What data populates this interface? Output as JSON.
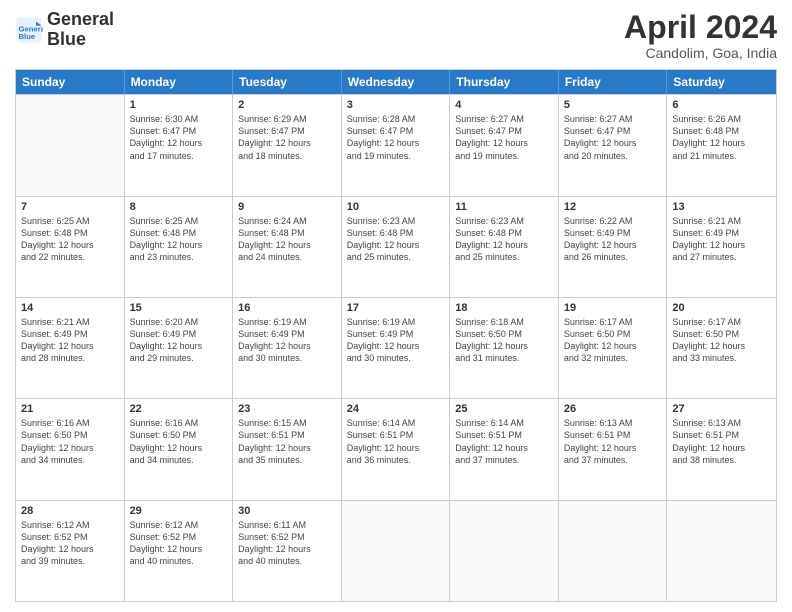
{
  "header": {
    "logo_line1": "General",
    "logo_line2": "Blue",
    "title": "April 2024",
    "subtitle": "Candolim, Goa, India"
  },
  "calendar": {
    "weekdays": [
      "Sunday",
      "Monday",
      "Tuesday",
      "Wednesday",
      "Thursday",
      "Friday",
      "Saturday"
    ],
    "weeks": [
      [
        {
          "day": "",
          "empty": true
        },
        {
          "day": "1",
          "sunrise": "6:30 AM",
          "sunset": "6:47 PM",
          "daylight": "12 hours and 17 minutes."
        },
        {
          "day": "2",
          "sunrise": "6:29 AM",
          "sunset": "6:47 PM",
          "daylight": "12 hours and 18 minutes."
        },
        {
          "day": "3",
          "sunrise": "6:28 AM",
          "sunset": "6:47 PM",
          "daylight": "12 hours and 19 minutes."
        },
        {
          "day": "4",
          "sunrise": "6:27 AM",
          "sunset": "6:47 PM",
          "daylight": "12 hours and 19 minutes."
        },
        {
          "day": "5",
          "sunrise": "6:27 AM",
          "sunset": "6:47 PM",
          "daylight": "12 hours and 20 minutes."
        },
        {
          "day": "6",
          "sunrise": "6:26 AM",
          "sunset": "6:48 PM",
          "daylight": "12 hours and 21 minutes."
        }
      ],
      [
        {
          "day": "7",
          "sunrise": "6:25 AM",
          "sunset": "6:48 PM",
          "daylight": "12 hours and 22 minutes."
        },
        {
          "day": "8",
          "sunrise": "6:25 AM",
          "sunset": "6:48 PM",
          "daylight": "12 hours and 23 minutes."
        },
        {
          "day": "9",
          "sunrise": "6:24 AM",
          "sunset": "6:48 PM",
          "daylight": "12 hours and 24 minutes."
        },
        {
          "day": "10",
          "sunrise": "6:23 AM",
          "sunset": "6:48 PM",
          "daylight": "12 hours and 25 minutes."
        },
        {
          "day": "11",
          "sunrise": "6:23 AM",
          "sunset": "6:48 PM",
          "daylight": "12 hours and 25 minutes."
        },
        {
          "day": "12",
          "sunrise": "6:22 AM",
          "sunset": "6:49 PM",
          "daylight": "12 hours and 26 minutes."
        },
        {
          "day": "13",
          "sunrise": "6:21 AM",
          "sunset": "6:49 PM",
          "daylight": "12 hours and 27 minutes."
        }
      ],
      [
        {
          "day": "14",
          "sunrise": "6:21 AM",
          "sunset": "6:49 PM",
          "daylight": "12 hours and 28 minutes."
        },
        {
          "day": "15",
          "sunrise": "6:20 AM",
          "sunset": "6:49 PM",
          "daylight": "12 hours and 29 minutes."
        },
        {
          "day": "16",
          "sunrise": "6:19 AM",
          "sunset": "6:49 PM",
          "daylight": "12 hours and 30 minutes."
        },
        {
          "day": "17",
          "sunrise": "6:19 AM",
          "sunset": "6:49 PM",
          "daylight": "12 hours and 30 minutes."
        },
        {
          "day": "18",
          "sunrise": "6:18 AM",
          "sunset": "6:50 PM",
          "daylight": "12 hours and 31 minutes."
        },
        {
          "day": "19",
          "sunrise": "6:17 AM",
          "sunset": "6:50 PM",
          "daylight": "12 hours and 32 minutes."
        },
        {
          "day": "20",
          "sunrise": "6:17 AM",
          "sunset": "6:50 PM",
          "daylight": "12 hours and 33 minutes."
        }
      ],
      [
        {
          "day": "21",
          "sunrise": "6:16 AM",
          "sunset": "6:50 PM",
          "daylight": "12 hours and 34 minutes."
        },
        {
          "day": "22",
          "sunrise": "6:16 AM",
          "sunset": "6:50 PM",
          "daylight": "12 hours and 34 minutes."
        },
        {
          "day": "23",
          "sunrise": "6:15 AM",
          "sunset": "6:51 PM",
          "daylight": "12 hours and 35 minutes."
        },
        {
          "day": "24",
          "sunrise": "6:14 AM",
          "sunset": "6:51 PM",
          "daylight": "12 hours and 36 minutes."
        },
        {
          "day": "25",
          "sunrise": "6:14 AM",
          "sunset": "6:51 PM",
          "daylight": "12 hours and 37 minutes."
        },
        {
          "day": "26",
          "sunrise": "6:13 AM",
          "sunset": "6:51 PM",
          "daylight": "12 hours and 37 minutes."
        },
        {
          "day": "27",
          "sunrise": "6:13 AM",
          "sunset": "6:51 PM",
          "daylight": "12 hours and 38 minutes."
        }
      ],
      [
        {
          "day": "28",
          "sunrise": "6:12 AM",
          "sunset": "6:52 PM",
          "daylight": "12 hours and 39 minutes."
        },
        {
          "day": "29",
          "sunrise": "6:12 AM",
          "sunset": "6:52 PM",
          "daylight": "12 hours and 40 minutes."
        },
        {
          "day": "30",
          "sunrise": "6:11 AM",
          "sunset": "6:52 PM",
          "daylight": "12 hours and 40 minutes."
        },
        {
          "day": "",
          "empty": true
        },
        {
          "day": "",
          "empty": true
        },
        {
          "day": "",
          "empty": true
        },
        {
          "day": "",
          "empty": true
        }
      ]
    ]
  }
}
